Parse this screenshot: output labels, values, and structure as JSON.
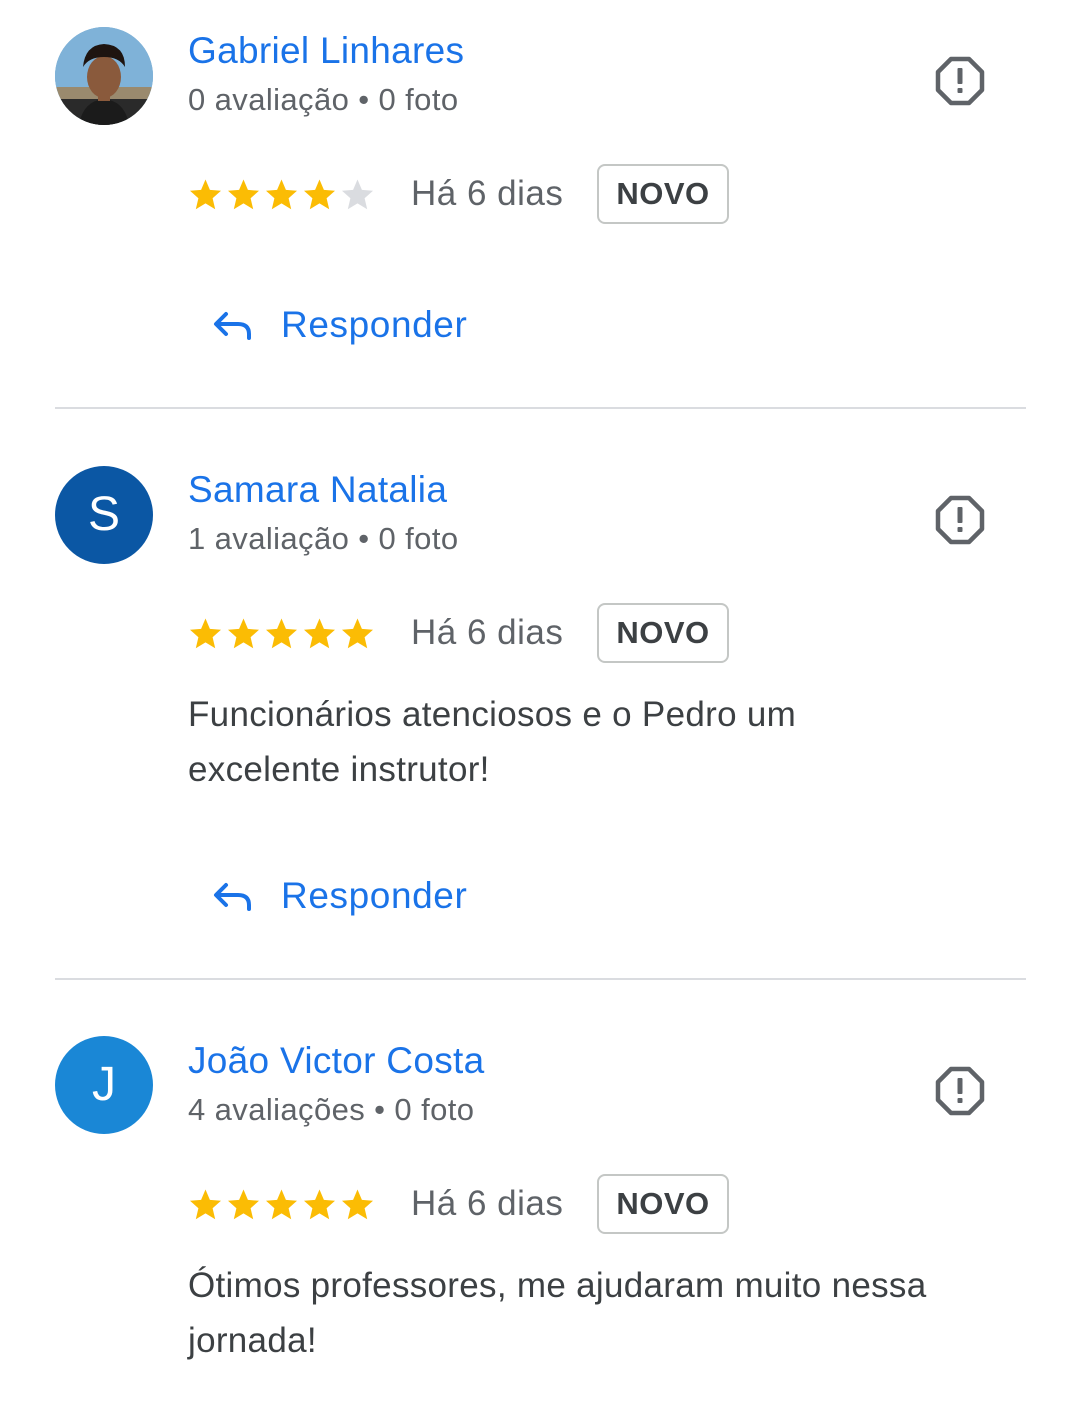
{
  "reviews": [
    {
      "author": "Gabriel Linhares",
      "meta": "0 avaliação • 0 foto",
      "avatar_type": "photo",
      "rating": 4,
      "max_rating": 5,
      "date": "Há 6 dias",
      "badge": "NOVO",
      "text": "",
      "reply_label": "Responder"
    },
    {
      "author": "Samara Natalia",
      "meta": "1 avaliação • 0 foto",
      "avatar_type": "letter",
      "avatar_letter": "S",
      "avatar_color": "#0b57a4",
      "rating": 5,
      "max_rating": 5,
      "date": "Há 6 dias",
      "badge": "NOVO",
      "text": "Funcionários atenciosos e o Pedro um excelente instrutor!",
      "reply_label": "Responder"
    },
    {
      "author": "João Victor Costa",
      "meta": "4 avaliações • 0 foto",
      "avatar_type": "letter",
      "avatar_letter": "J",
      "avatar_color": "#1a87d6",
      "rating": 5,
      "max_rating": 5,
      "date": "Há 6 dias",
      "badge": "NOVO",
      "text": "Ótimos professores, me ajudaram muito nessa jornada!"
    }
  ],
  "colors": {
    "accent": "#1a73e8",
    "star_filled": "#fbbc04",
    "star_empty": "#dadce0",
    "icon_gray": "#5f6368"
  },
  "icons": {
    "flag": "report-octagon-icon",
    "star": "star-icon",
    "reply": "reply-arrow-icon"
  }
}
